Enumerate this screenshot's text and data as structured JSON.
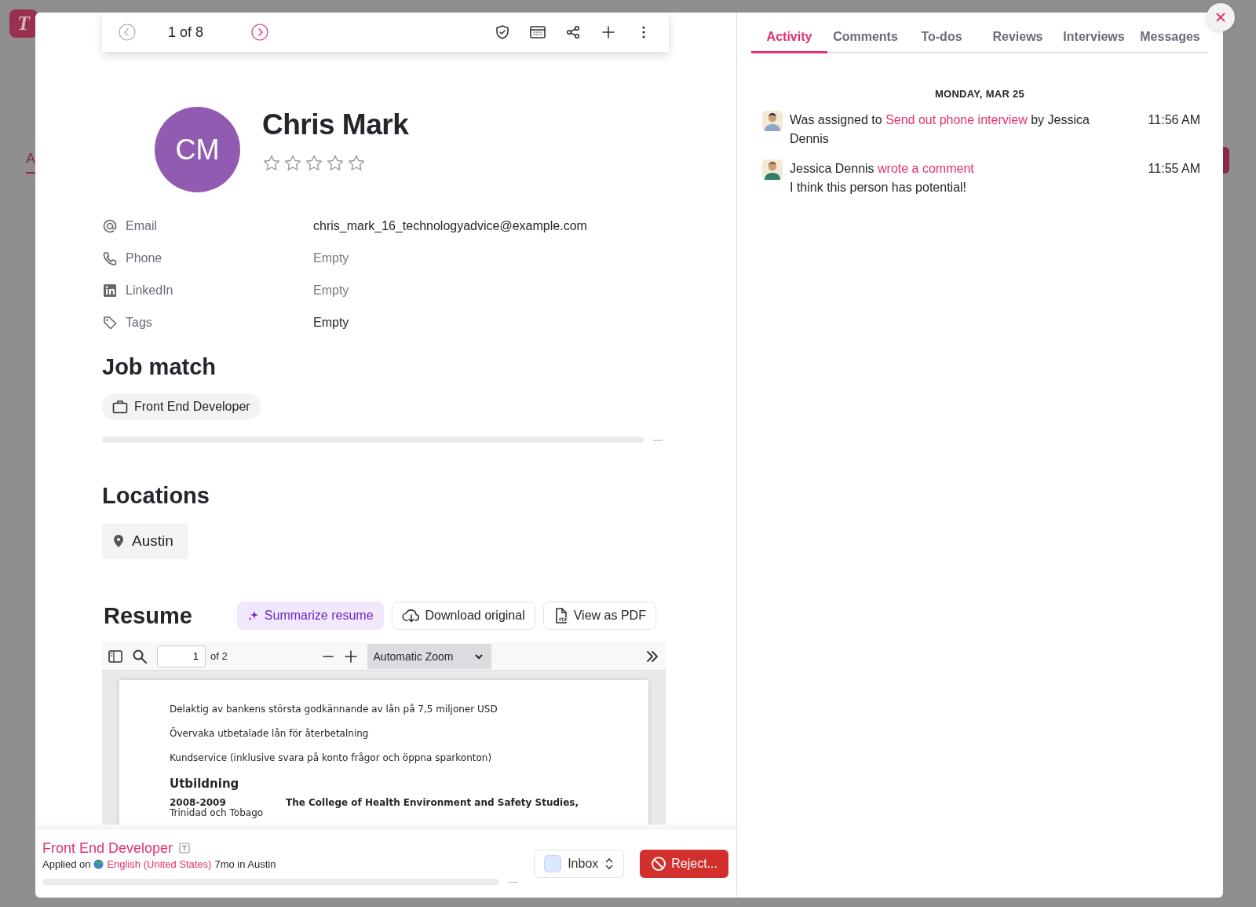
{
  "backdrop": {
    "logo": "T",
    "tab": "A"
  },
  "toolbar": {
    "counter": "1 of 8"
  },
  "candidate": {
    "initials": "CM",
    "name": "Chris Mark",
    "stars": 0
  },
  "fields": [
    {
      "kind": "email",
      "label": "Email",
      "value": "chris_mark_16_technologyadvice@example.com",
      "muted": false
    },
    {
      "kind": "phone",
      "label": "Phone",
      "value": "Empty",
      "muted": true
    },
    {
      "kind": "linkedin",
      "label": "LinkedIn",
      "value": "Empty",
      "muted": true
    },
    {
      "kind": "tags",
      "label": "Tags",
      "value": "Empty",
      "muted": false
    }
  ],
  "job_match": {
    "title": "Job match",
    "job": "Front End Developer",
    "score": "—"
  },
  "locations": {
    "title": "Locations",
    "items": [
      "Austin"
    ]
  },
  "resume": {
    "title": "Resume",
    "buttons": [
      {
        "kind": "summarize",
        "label": "Summarize resume"
      },
      {
        "kind": "download",
        "label": "Download original"
      },
      {
        "kind": "pdf",
        "label": "View as PDF"
      }
    ],
    "viewer": {
      "page": "1",
      "of": "of 2",
      "zoom": "Automatic Zoom",
      "lines": [
        {
          "kind": "text",
          "text": "Delaktig av bankens största godkännande av lån på 7,5 miljoner USD"
        },
        {
          "kind": "text",
          "text": "Övervaka utbetalade lån för återbetalning"
        },
        {
          "kind": "text",
          "text": "Kundservice (inklusive svara på konto frågor och öppna sparkonton)"
        },
        {
          "kind": "heading",
          "text": "Utbildning"
        },
        {
          "kind": "entry",
          "date": "2008-2009",
          "text": "The College of Health Environment and Safety Studies,",
          "place": "Trinidad och Tobago"
        }
      ]
    }
  },
  "footer": {
    "job": "Front End Developer",
    "applied": "Applied on",
    "language": "English (United States)",
    "rest": "7mo in Austin",
    "score": "—",
    "stage": "Inbox",
    "reject": "Reject..."
  },
  "tabs": [
    {
      "label": "Activity",
      "selected": true
    },
    {
      "label": "Comments",
      "selected": false
    },
    {
      "label": "To-dos",
      "selected": false
    },
    {
      "label": "Reviews",
      "selected": false
    },
    {
      "label": "Interviews",
      "selected": false
    },
    {
      "label": "Messages",
      "selected": false
    }
  ],
  "activity": {
    "date": "MONDAY, MAR 25",
    "entries": [
      {
        "before": "Was assigned to ",
        "link": "Send out phone interview",
        "after": " by Jessica Dennis",
        "time": "11:56 AM"
      },
      {
        "before": "Jessica Dennis ",
        "link": "wrote a comment",
        "note": "I think this person has potential!",
        "time": "11:55 AM"
      }
    ]
  }
}
